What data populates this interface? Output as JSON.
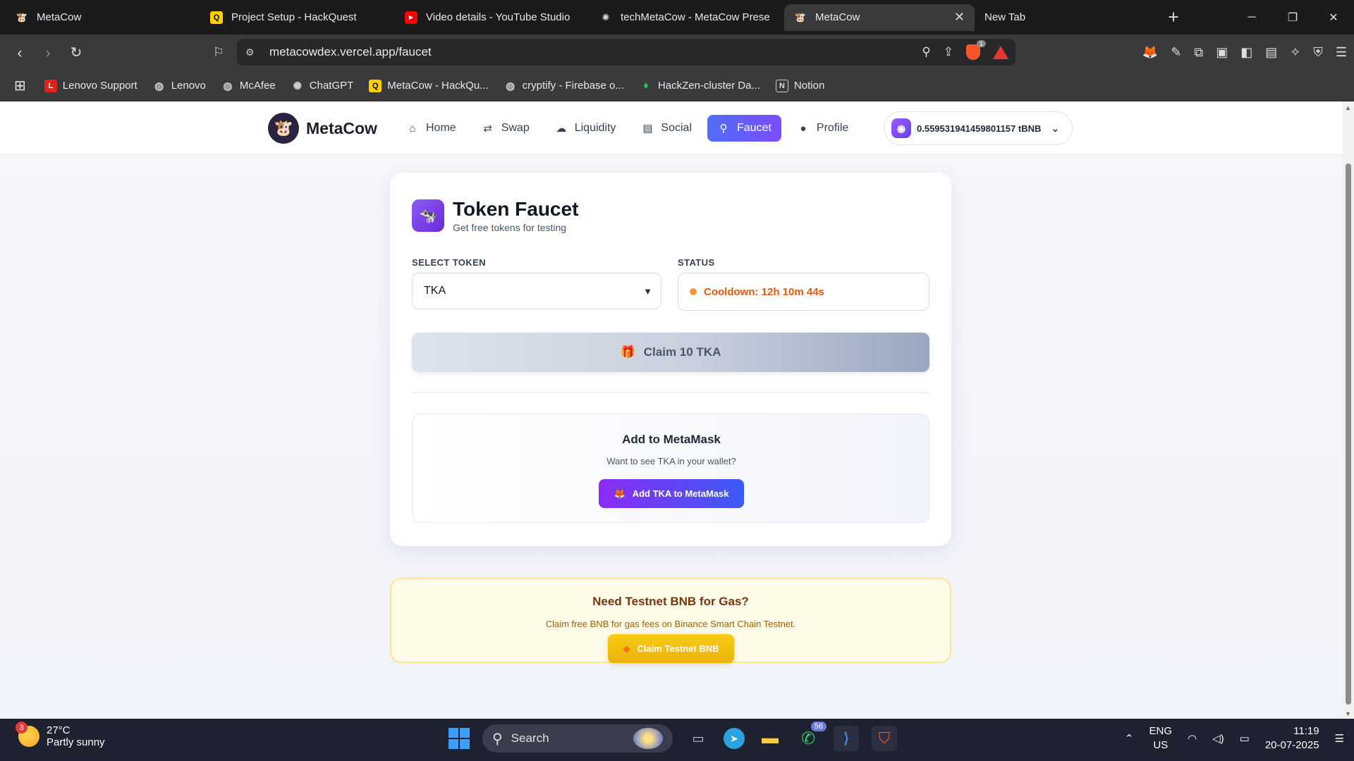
{
  "browser": {
    "tabs": [
      {
        "title": "MetaCow",
        "active": false
      },
      {
        "title": "Project Setup - HackQuest",
        "active": false
      },
      {
        "title": "Video details - YouTube Studio",
        "active": false
      },
      {
        "title": "techMetaCow - MetaCow Prese",
        "active": false
      },
      {
        "title": "MetaCow",
        "active": true
      },
      {
        "title": "New Tab",
        "active": false
      }
    ],
    "url": "metacowdex.vercel.app/faucet",
    "brave_badge": "1",
    "bookmarks": [
      "Lenovo Support",
      "Lenovo",
      "McAfee",
      "ChatGPT",
      "MetaCow - HackQu...",
      "cryptify - Firebase o...",
      "HackZen-cluster Da...",
      "Notion"
    ]
  },
  "app": {
    "brand": "MetaCow",
    "nav": [
      {
        "label": "Home",
        "icon": "home-icon"
      },
      {
        "label": "Swap",
        "icon": "swap-arrows-icon"
      },
      {
        "label": "Liquidity",
        "icon": "droplet-icon"
      },
      {
        "label": "Social",
        "icon": "chat-icon"
      },
      {
        "label": "Faucet",
        "icon": "map-pin-icon"
      },
      {
        "label": "Profile",
        "icon": "user-icon"
      }
    ],
    "active_nav": "Faucet",
    "wallet_balance": "0.559531941459801157 tBNB"
  },
  "faucet": {
    "title": "Token Faucet",
    "subtitle": "Get free tokens for testing",
    "select_label": "SELECT TOKEN",
    "selected_token": "TKA",
    "status_label": "STATUS",
    "status_text": "Cooldown: 12h 10m 44s",
    "claim_label": "Claim 10 TKA",
    "metamask": {
      "title": "Add to MetaMask",
      "subtitle": "Want to see TKA in your wallet?",
      "button": "Add TKA to MetaMask"
    }
  },
  "bnb": {
    "title": "Need Testnet BNB for Gas?",
    "subtitle": "Claim free BNB for gas fees on Binance Smart Chain Testnet.",
    "button": "Claim Testnet BNB"
  },
  "taskbar": {
    "weather_badge": "3",
    "temperature": "27°C",
    "condition": "Partly sunny",
    "search_placeholder": "Search",
    "whatsapp_count": "56",
    "lang_1": "ENG",
    "lang_2": "US",
    "time": "11:19",
    "date": "20-07-2025"
  },
  "colors": {
    "accent": "#6366f1",
    "status_warning": "#ea580c",
    "bnb_yellow": "#eab308"
  }
}
